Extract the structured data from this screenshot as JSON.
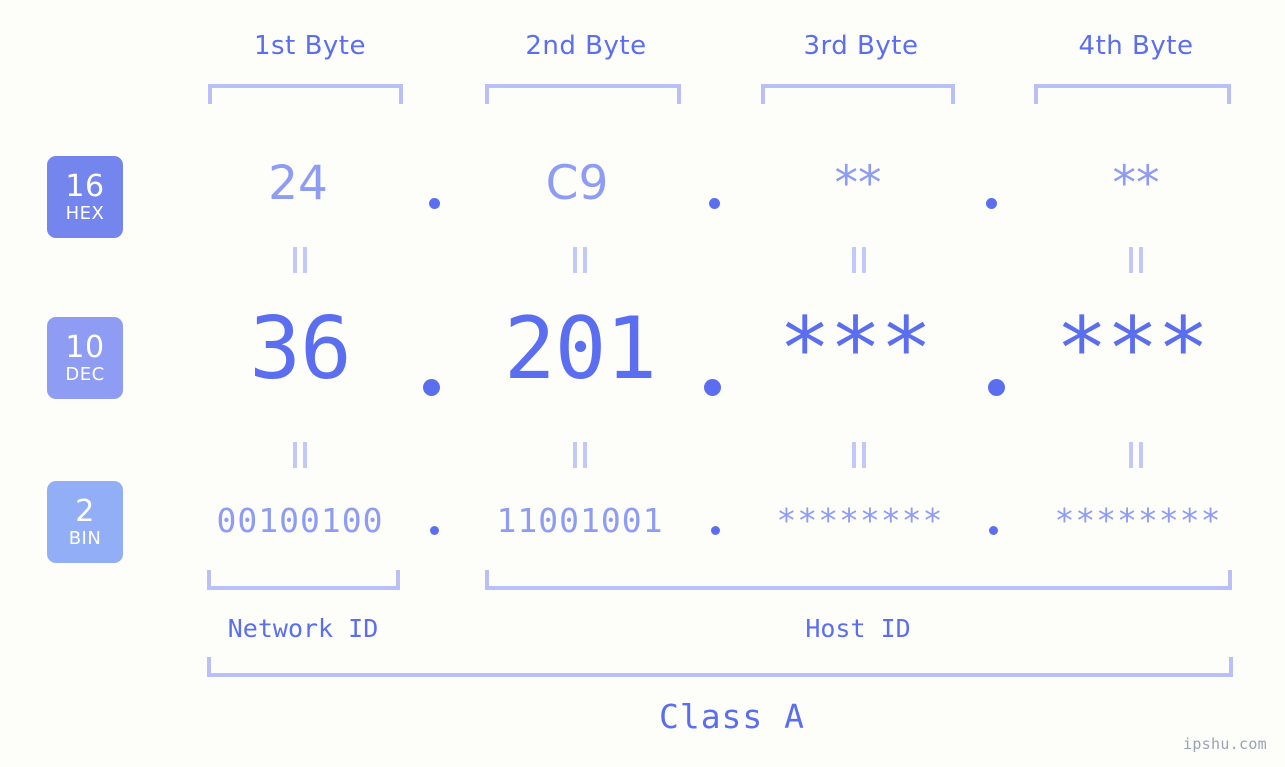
{
  "meta": {
    "watermark": "ipshu.com",
    "background_color": "#fdfdfa",
    "accent_color": "#5b6ef0",
    "accent_light_color": "#8e9cf4",
    "bracket_color": "#b9c0f7"
  },
  "headers": [
    {
      "label": "1st Byte"
    },
    {
      "label": "2nd Byte"
    },
    {
      "label": "3rd Byte"
    },
    {
      "label": "4th Byte"
    }
  ],
  "radix_badges": [
    {
      "number": "16",
      "system": "HEX",
      "color": "#7585ee"
    },
    {
      "number": "10",
      "system": "DEC",
      "color": "#8f9cf3"
    },
    {
      "number": "2",
      "system": "BIN",
      "color": "#91aef7"
    }
  ],
  "rows": {
    "hex": {
      "radix": "16",
      "system": "HEX",
      "values": [
        "24",
        "C9",
        "**",
        "**"
      ]
    },
    "dec": {
      "radix": "10",
      "system": "DEC",
      "values": [
        "36",
        "201",
        "***",
        "***"
      ]
    },
    "bin": {
      "radix": "2",
      "system": "BIN",
      "values": [
        "00100100",
        "11001001",
        "********",
        "********"
      ]
    }
  },
  "separators": {
    "dot": "."
  },
  "equality_marks": [
    "=",
    "=",
    "=",
    "="
  ],
  "sections": [
    {
      "label": "Network ID"
    },
    {
      "label": "Host ID"
    }
  ],
  "class": {
    "label": "Class A"
  }
}
